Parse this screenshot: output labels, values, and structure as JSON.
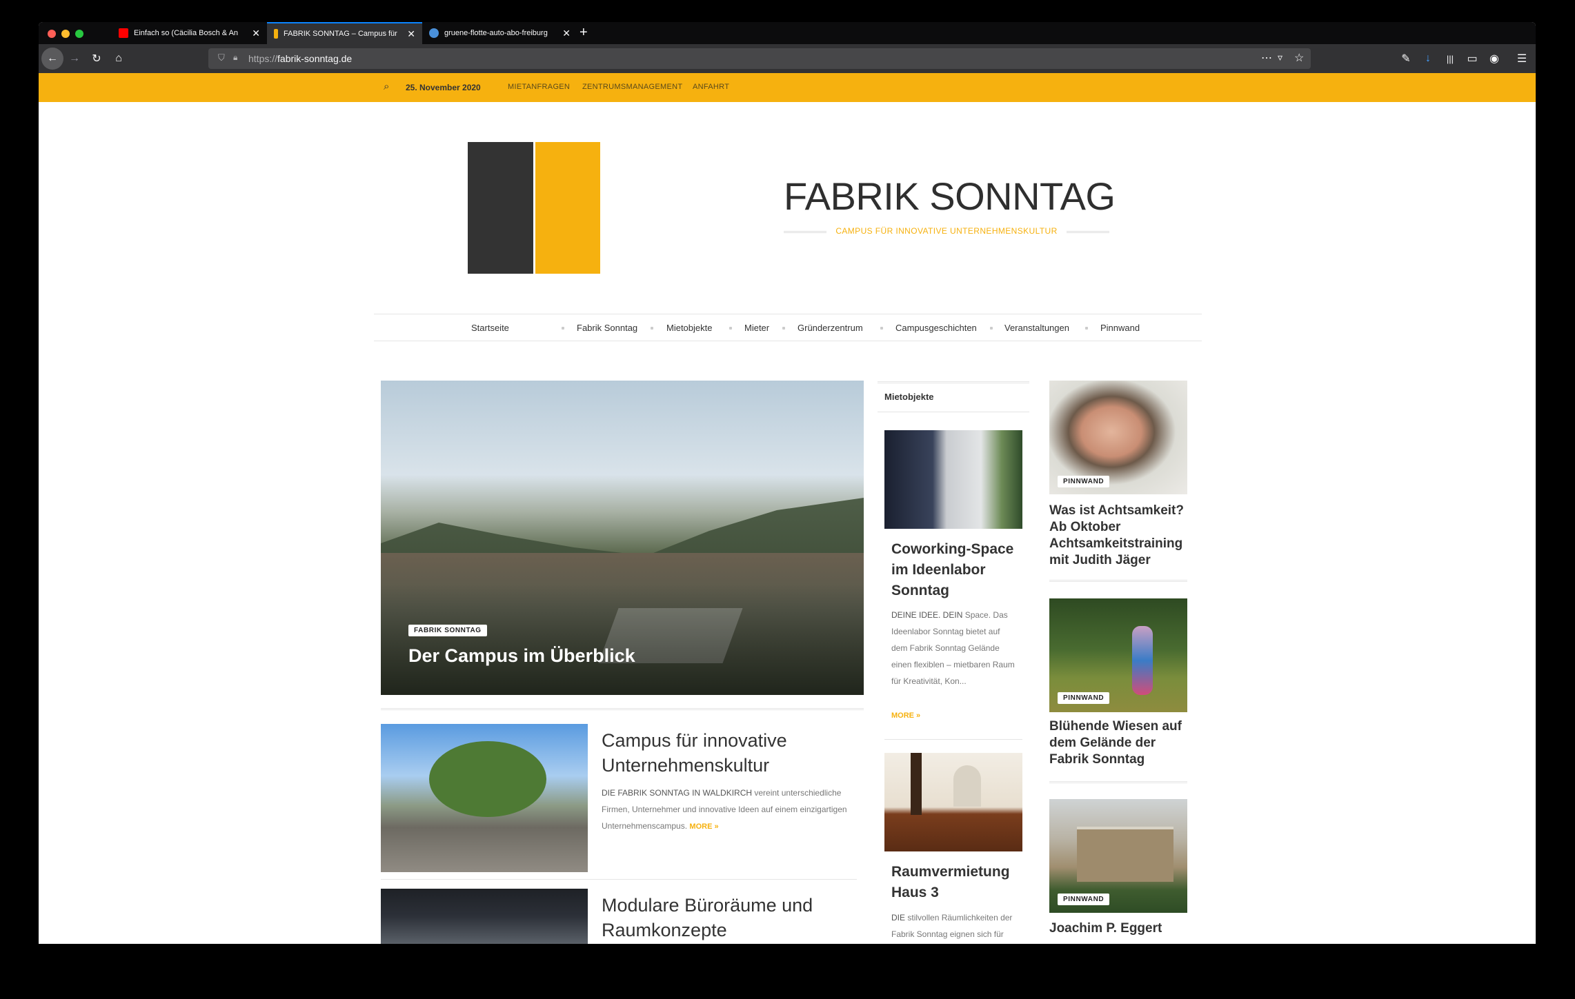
{
  "browser": {
    "tabs": [
      {
        "title": "Einfach so (Cäcilia Bosch & An",
        "favicon_color": "#ff0000",
        "active": false
      },
      {
        "title": "FABRIK SONNTAG – Campus für",
        "favicon_color": "#f6b10f",
        "active": true
      },
      {
        "title": "gruene-flotte-auto-abo-freiburg",
        "favicon_color": "#4a90d9",
        "active": false
      }
    ],
    "new_tab_icon": "+",
    "url_protocol": "https://",
    "url_host": "fabrik-sonntag.de"
  },
  "topbar": {
    "date": "25. November 2020",
    "links": [
      "MIETANFRAGEN",
      "ZENTRUMSMANAGEMENT",
      "ANFAHRT"
    ]
  },
  "header": {
    "title": "FABRIK SONNTAG",
    "tagline": "CAMPUS FÜR INNOVATIVE UNTERNEHMENSKULTUR"
  },
  "nav": [
    "Startseite",
    "Fabrik Sonntag",
    "Mietobjekte",
    "Mieter",
    "Gründerzentrum",
    "Campusgeschichten",
    "Veranstaltungen",
    "Pinnwand"
  ],
  "hero": {
    "category": "FABRIK SONNTAG",
    "title": "Der Campus im Überblick"
  },
  "posts": [
    {
      "title": "Campus für innovative Unternehmenskultur",
      "lead": "DIE FABRIK SONNTAG IN WALDKIRCH",
      "excerpt": "vereint unterschiedliche Firmen, Unternehmer und innovative Ideen auf einem einzigartigen Unternehmenscampus.",
      "more": "MORE »"
    },
    {
      "title": "Modulare Büroräume und Raumkonzepte"
    }
  ],
  "mietobjekte": {
    "widget_title": "Mietobjekte",
    "items": [
      {
        "title": "Coworking-Space im Ideenlabor Sonntag",
        "lead": "DEINE IDEE. DEIN",
        "excerpt": "Space. Das Ideenlabor Sonntag bietet auf dem Fabrik Sonntag Gelände einen flexiblen – mietbaren Raum für Kreativität, Kon...",
        "more": "MORE »"
      },
      {
        "title": "Raumvermietung Haus 3",
        "lead": "DIE",
        "excerpt": "stilvollen Räumlichkeiten der Fabrik Sonntag eignen sich für alle Arten von Bewegungs- und"
      }
    ]
  },
  "pinnwand": [
    {
      "category": "PINNWAND",
      "title": "Was ist Achtsamkeit? Ab Oktober Achtsamkeitstraining mit Judith Jäger"
    },
    {
      "category": "PINNWAND",
      "title": "Blühende Wiesen auf dem Gelände der Fabrik Sonntag"
    },
    {
      "category": "PINNWAND",
      "title": "Joachim P. Eggert"
    }
  ],
  "colors": {
    "accent": "#f6b10f",
    "logo_dark": "#333333",
    "text": "#333333"
  }
}
